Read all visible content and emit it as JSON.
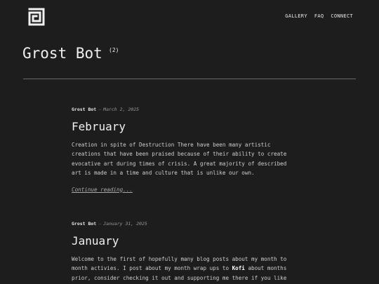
{
  "header": {
    "logo_icon": "square-spiral-logo",
    "nav": [
      "GALLERY",
      "FAQ",
      "CONNECT"
    ]
  },
  "page": {
    "title": "Grost Bot",
    "count": "(2)"
  },
  "posts": [
    {
      "author": "Grost Bot",
      "date": "March 2, 2025",
      "title": "February",
      "body": "Creation in spite of Destruction There have been many artistic\ncreations that have been praised because of their ability to create\nevocative art during times of crisis. A great majority of described\nart is made in a time and culture that is unlike our own.",
      "link": "Continue reading..."
    },
    {
      "author": "Grost Bot",
      "date": "January 31, 2025",
      "title": "January",
      "body_pre": "Welcome to the first of hopefully many blog posts about my month to\nmonth activies. I post about my month wrap ups to ",
      "body_highlight": "Kofi",
      "body_post": " about months\nprior, consider checking it out and supporting me there if you like"
    }
  ],
  "colors": {
    "background": "#1d1d1d",
    "text": "#e8e8e8",
    "muted": "#9a9a9a",
    "rule": "#6a6a6a"
  }
}
